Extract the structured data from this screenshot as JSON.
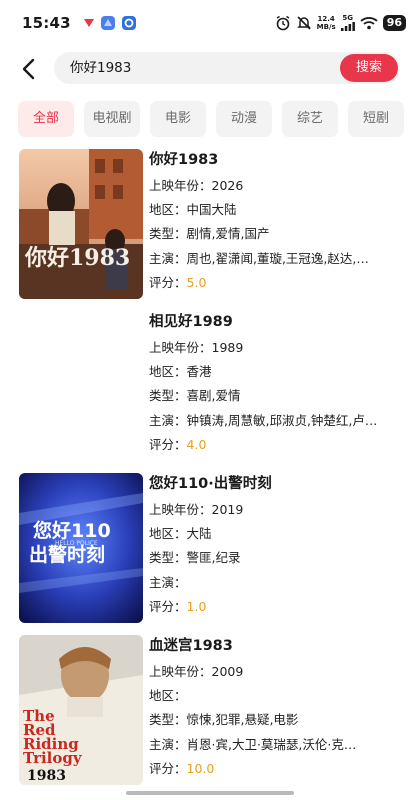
{
  "status_bar": {
    "time": "15:43",
    "net_speed_value": "12.4",
    "net_speed_unit": "MB/s",
    "signal_label": "5G",
    "battery": "96"
  },
  "search": {
    "query": "你好1983",
    "button_label": "搜索"
  },
  "tabs": [
    {
      "label": "全部",
      "active": true
    },
    {
      "label": "电视剧"
    },
    {
      "label": "电影"
    },
    {
      "label": "动漫"
    },
    {
      "label": "综艺"
    },
    {
      "label": "短剧"
    }
  ],
  "labels": {
    "year": "上映年份：",
    "region": "地区：",
    "genre": "类型：",
    "cast": "主演：",
    "rating": "评分："
  },
  "results": [
    {
      "title": "你好1983",
      "year": "2026",
      "region": "中国大陆",
      "genre": "剧情,爱情,国产",
      "cast": "周也,翟潇闻,董璇,王冠逸,赵达,…",
      "rating": "5.0",
      "poster_text": "你好1983"
    },
    {
      "title": "相见好1989",
      "year": "1989",
      "region": "香港",
      "genre": "喜剧,爱情",
      "cast": "钟镇涛,周慧敏,邱淑贞,钟楚红,卢…",
      "rating": "4.0"
    },
    {
      "title": "您好110·出警时刻",
      "year": "2019",
      "region": "大陆",
      "genre": "警匪,纪录",
      "cast": "",
      "rating": "1.0",
      "poster_line1": "您好110",
      "poster_line2": "出警时刻",
      "poster_small": "HELLO POLICE"
    },
    {
      "title": "血迷宫1983",
      "year": "2009",
      "region": "",
      "genre": "惊悚,犯罪,悬疑,电影",
      "cast": "肖恩·宾,大卫·莫瑞瑟,沃伦·克…",
      "rating": "10.0",
      "poster_line1": "The",
      "poster_line2": "Red",
      "poster_line3": "Riding",
      "poster_line4": "Trilogy",
      "poster_year": "1983"
    }
  ],
  "colors": {
    "accent": "#e8364a",
    "rating": "#e8a020",
    "tab_bg": "#f3f3f3",
    "active_tab_bg": "#fdeaea"
  }
}
